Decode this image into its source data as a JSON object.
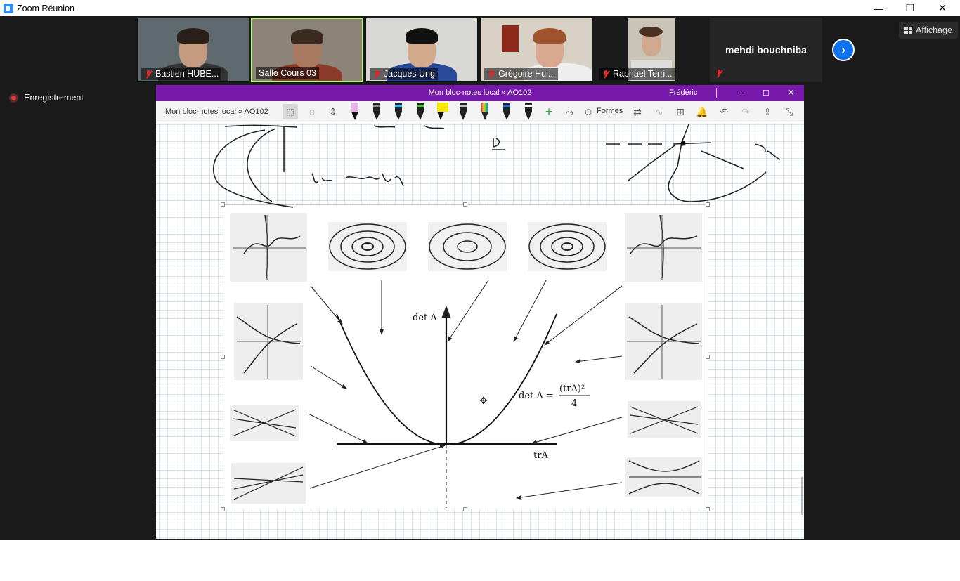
{
  "window": {
    "app_title": "Zoom Réunion",
    "controls": {
      "minimize": "—",
      "restore": "❐",
      "close": "✕"
    }
  },
  "participants": [
    {
      "name": "Bastien HUBE...",
      "muted": true
    },
    {
      "name": "Salle Cours 03",
      "muted": false,
      "active": true
    },
    {
      "name": "Jacques Ung",
      "muted": true
    },
    {
      "name": "Grégoire Hui...",
      "muted": true
    },
    {
      "name": "Raphael Terri...",
      "muted": true
    }
  ],
  "name_card": {
    "name": "mehdi bouchniba",
    "muted": true
  },
  "view_button": {
    "label": "Affichage"
  },
  "recording": {
    "label": "Enregistrement"
  },
  "onenote": {
    "title": "Mon bloc-notes local » AO102",
    "user": "Frédéric",
    "breadcrumb": "Mon bloc-notes local » AO102",
    "formes_label": "Formes"
  },
  "figure": {
    "det_label": "det A",
    "tr_label": "trA",
    "formula_lhs": "det A =",
    "formula_num": "(trA)²",
    "formula_den": "4"
  },
  "colors": {
    "zoom_bg": "#1a1a1a",
    "onenote_purple": "#7719aa",
    "zoom_blue": "#0e72ed"
  }
}
